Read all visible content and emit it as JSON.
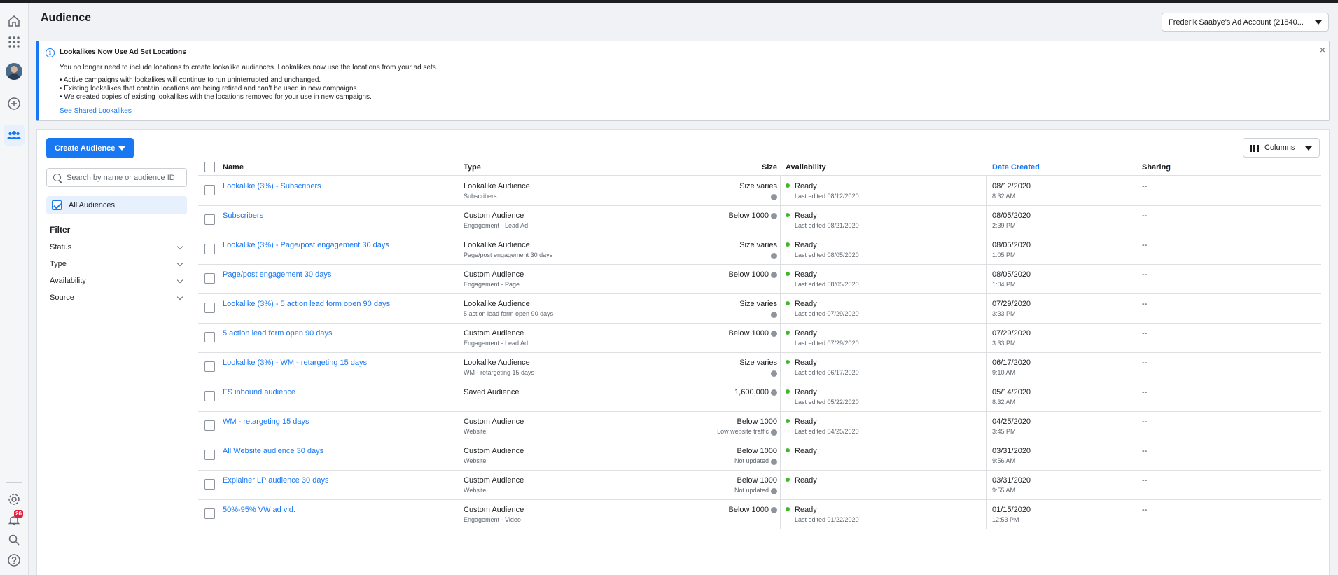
{
  "page": {
    "title": "Audience"
  },
  "account": {
    "label": "Frederik Saabye's Ad Account (21840..."
  },
  "rail": {
    "notifications_count": "26"
  },
  "notice": {
    "title": "Lookalikes Now Use Ad Set Locations",
    "intro": "You no longer need to include locations to create lookalike audiences. Lookalikes now use the locations from your ad sets.",
    "bullets": [
      "Active campaigns with lookalikes will continue to run uninterrupted and unchanged.",
      "Existing lookalikes that contain locations are being retired and can't be used in new campaigns.",
      "We created copies of existing lookalikes with the locations removed for your use in new campaigns."
    ],
    "link": "See Shared Lookalikes",
    "close": "×"
  },
  "toolbar": {
    "create_label": "Create Audience",
    "columns_label": "Columns"
  },
  "search": {
    "placeholder": "Search by name or audience ID"
  },
  "sidebar": {
    "all_label": "All Audiences",
    "filter_title": "Filter",
    "filters": [
      "Status",
      "Type",
      "Availability",
      "Source"
    ]
  },
  "table": {
    "headers": {
      "name": "Name",
      "type": "Type",
      "size": "Size",
      "availability": "Availability",
      "date": "Date Created",
      "sharing": "Sharing"
    },
    "rows": [
      {
        "name": "Lookalike (3%) - Subscribers",
        "type": "Lookalike Audience",
        "subtype": "Subscribers",
        "size": "Size varies",
        "size_note": "",
        "availability": "Ready",
        "edited": "Last edited 08/12/2020",
        "date": "08/12/2020",
        "time": "8:32 AM",
        "sharing": "--"
      },
      {
        "name": "Subscribers",
        "type": "Custom Audience",
        "subtype": "Engagement - Lead Ad",
        "size": "Below 1000",
        "size_note": "",
        "availability": "Ready",
        "edited": "Last edited 08/21/2020",
        "date": "08/05/2020",
        "time": "2:39 PM",
        "sharing": "--"
      },
      {
        "name": "Lookalike (3%) - Page/post engagement 30 days",
        "type": "Lookalike Audience",
        "subtype": "Page/post engagement 30 days",
        "size": "Size varies",
        "size_note": "",
        "availability": "Ready",
        "edited": "Last edited 08/05/2020",
        "date": "08/05/2020",
        "time": "1:05 PM",
        "sharing": "--"
      },
      {
        "name": "Page/post engagement 30 days",
        "type": "Custom Audience",
        "subtype": "Engagement - Page",
        "size": "Below 1000",
        "size_note": "",
        "availability": "Ready",
        "edited": "Last edited 08/05/2020",
        "date": "08/05/2020",
        "time": "1:04 PM",
        "sharing": "--"
      },
      {
        "name": "Lookalike (3%) - 5 action lead form open 90 days",
        "type": "Lookalike Audience",
        "subtype": "5 action lead form open 90 days",
        "size": "Size varies",
        "size_note": "",
        "availability": "Ready",
        "edited": "Last edited 07/29/2020",
        "date": "07/29/2020",
        "time": "3:33 PM",
        "sharing": "--"
      },
      {
        "name": "5 action lead form open 90 days",
        "type": "Custom Audience",
        "subtype": "Engagement - Lead Ad",
        "size": "Below 1000",
        "size_note": "",
        "availability": "Ready",
        "edited": "Last edited 07/29/2020",
        "date": "07/29/2020",
        "time": "3:33 PM",
        "sharing": "--"
      },
      {
        "name": "Lookalike (3%) - WM - retargeting 15 days",
        "type": "Lookalike Audience",
        "subtype": "WM - retargeting 15 days",
        "size": "Size varies",
        "size_note": "",
        "availability": "Ready",
        "edited": "Last edited 06/17/2020",
        "date": "06/17/2020",
        "time": "9:10 AM",
        "sharing": "--"
      },
      {
        "name": "FS inbound audience",
        "type": "Saved Audience",
        "subtype": "",
        "size": "1,600,000",
        "size_note": "",
        "availability": "Ready",
        "edited": "Last edited 05/22/2020",
        "date": "05/14/2020",
        "time": "8:32 AM",
        "sharing": "--"
      },
      {
        "name": "WM - retargeting 15 days",
        "type": "Custom Audience",
        "subtype": "Website",
        "size": "Below 1000",
        "size_note": "Low website traffic",
        "availability": "Ready",
        "edited": "Last edited 04/25/2020",
        "date": "04/25/2020",
        "time": "3:45 PM",
        "sharing": "--"
      },
      {
        "name": "All Website audience 30 days",
        "type": "Custom Audience",
        "subtype": "Website",
        "size": "Below 1000",
        "size_note": "Not updated",
        "availability": "Ready",
        "edited": "",
        "date": "03/31/2020",
        "time": "9:56 AM",
        "sharing": "--"
      },
      {
        "name": "Explainer LP audience 30 days",
        "type": "Custom Audience",
        "subtype": "Website",
        "size": "Below 1000",
        "size_note": "Not updated",
        "availability": "Ready",
        "edited": "",
        "date": "03/31/2020",
        "time": "9:55 AM",
        "sharing": "--"
      },
      {
        "name": "50%-95% VW ad vid.",
        "type": "Custom Audience",
        "subtype": "Engagement - Video",
        "size": "Below 1000",
        "size_note": "",
        "availability": "Ready",
        "edited": "Last edited 01/22/2020",
        "date": "01/15/2020",
        "time": "12:53 PM",
        "sharing": "--"
      }
    ]
  },
  "colors": {
    "accent": "#1877f2",
    "ready": "#42b72a",
    "badge": "#e41e3f"
  }
}
